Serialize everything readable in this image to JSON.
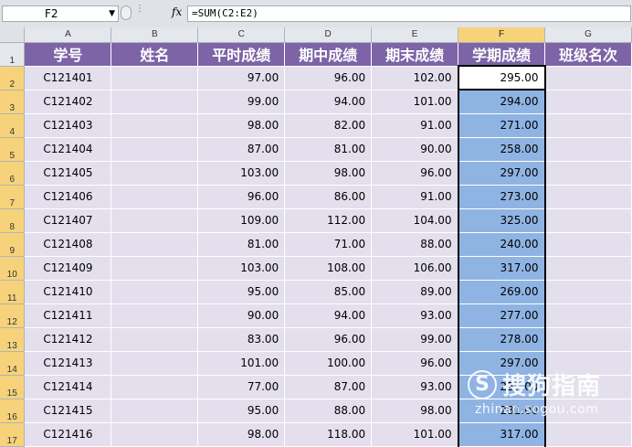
{
  "formula_bar": {
    "name_box": "F2",
    "fx_label": "fx",
    "formula": "=SUM(C2:E2)"
  },
  "columns": [
    "A",
    "B",
    "C",
    "D",
    "E",
    "F",
    "G"
  ],
  "selected_column": "F",
  "header_row": {
    "row_number": "1",
    "labels": [
      "学号",
      "姓名",
      "平时成绩",
      "期中成绩",
      "期末成绩",
      "学期成绩",
      "班级名次"
    ]
  },
  "rows": [
    {
      "row": "2",
      "id": "C121401",
      "name": "",
      "c": "97.00",
      "d": "96.00",
      "e": "102.00",
      "f": "295.00",
      "g": ""
    },
    {
      "row": "3",
      "id": "C121402",
      "name": "",
      "c": "99.00",
      "d": "94.00",
      "e": "101.00",
      "f": "294.00",
      "g": ""
    },
    {
      "row": "4",
      "id": "C121403",
      "name": "",
      "c": "98.00",
      "d": "82.00",
      "e": "91.00",
      "f": "271.00",
      "g": ""
    },
    {
      "row": "5",
      "id": "C121404",
      "name": "",
      "c": "87.00",
      "d": "81.00",
      "e": "90.00",
      "f": "258.00",
      "g": ""
    },
    {
      "row": "6",
      "id": "C121405",
      "name": "",
      "c": "103.00",
      "d": "98.00",
      "e": "96.00",
      "f": "297.00",
      "g": ""
    },
    {
      "row": "7",
      "id": "C121406",
      "name": "",
      "c": "96.00",
      "d": "86.00",
      "e": "91.00",
      "f": "273.00",
      "g": ""
    },
    {
      "row": "8",
      "id": "C121407",
      "name": "",
      "c": "109.00",
      "d": "112.00",
      "e": "104.00",
      "f": "325.00",
      "g": ""
    },
    {
      "row": "9",
      "id": "C121408",
      "name": "",
      "c": "81.00",
      "d": "71.00",
      "e": "88.00",
      "f": "240.00",
      "g": ""
    },
    {
      "row": "10",
      "id": "C121409",
      "name": "",
      "c": "103.00",
      "d": "108.00",
      "e": "106.00",
      "f": "317.00",
      "g": ""
    },
    {
      "row": "11",
      "id": "C121410",
      "name": "",
      "c": "95.00",
      "d": "85.00",
      "e": "89.00",
      "f": "269.00",
      "g": ""
    },
    {
      "row": "12",
      "id": "C121411",
      "name": "",
      "c": "90.00",
      "d": "94.00",
      "e": "93.00",
      "f": "277.00",
      "g": ""
    },
    {
      "row": "13",
      "id": "C121412",
      "name": "",
      "c": "83.00",
      "d": "96.00",
      "e": "99.00",
      "f": "278.00",
      "g": ""
    },
    {
      "row": "14",
      "id": "C121413",
      "name": "",
      "c": "101.00",
      "d": "100.00",
      "e": "96.00",
      "f": "297.00",
      "g": ""
    },
    {
      "row": "15",
      "id": "C121414",
      "name": "",
      "c": "77.00",
      "d": "87.00",
      "e": "93.00",
      "f": "257.00",
      "g": ""
    },
    {
      "row": "16",
      "id": "C121415",
      "name": "",
      "c": "95.00",
      "d": "88.00",
      "e": "98.00",
      "f": "281.00",
      "g": ""
    },
    {
      "row": "17",
      "id": "C121416",
      "name": "",
      "c": "98.00",
      "d": "118.00",
      "e": "101.00",
      "f": "317.00",
      "g": ""
    }
  ],
  "watermark": {
    "logo_letter": "S",
    "brand": "搜狗指南",
    "url": "zhinan.sogou.com"
  },
  "colors": {
    "header_bg": "#7d64a6",
    "cell_bg": "#e3dfec",
    "selected_bg": "#8fb4e3",
    "selected_header": "#f6d37a"
  }
}
